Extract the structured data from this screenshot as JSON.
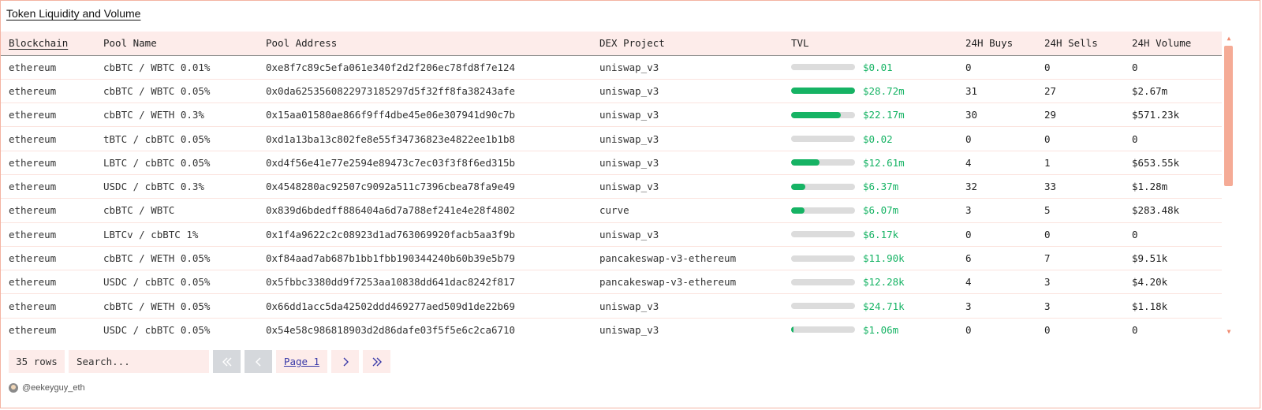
{
  "title": "Token Liquidity and Volume",
  "columns": [
    "Blockchain",
    "Pool Name",
    "Pool Address",
    "DEX Project",
    "TVL",
    "24H Buys",
    "24H Sells",
    "24H Volume"
  ],
  "rows": [
    {
      "chain": "ethereum",
      "pool": "cbBTC / WBTC 0.01%",
      "address": "0xe8f7c89c5efa061e340f2d2f206ec78fd8f7e124",
      "dex": "uniswap_v3",
      "tvl": "$0.01",
      "tvl_share": 0.0,
      "buys": "0",
      "sells": "0",
      "volume": "0"
    },
    {
      "chain": "ethereum",
      "pool": "cbBTC / WBTC 0.05%",
      "address": "0x0da6253560822973185297d5f32ff8fa38243afe",
      "dex": "uniswap_v3",
      "tvl": "$28.72m",
      "tvl_share": 1.0,
      "buys": "31",
      "sells": "27",
      "volume": "$2.67m"
    },
    {
      "chain": "ethereum",
      "pool": "cbBTC / WETH 0.3%",
      "address": "0x15aa01580ae866f9ff4dbe45e06e307941d90c7b",
      "dex": "uniswap_v3",
      "tvl": "$22.17m",
      "tvl_share": 0.772,
      "buys": "30",
      "sells": "29",
      "volume": "$571.23k"
    },
    {
      "chain": "ethereum",
      "pool": "tBTC / cbBTC 0.05%",
      "address": "0xd1a13ba13c802fe8e55f34736823e4822ee1b1b8",
      "dex": "uniswap_v3",
      "tvl": "$0.02",
      "tvl_share": 0.0,
      "buys": "0",
      "sells": "0",
      "volume": "0"
    },
    {
      "chain": "ethereum",
      "pool": "LBTC / cbBTC 0.05%",
      "address": "0xd4f56e41e77e2594e89473c7ec03f3f8f6ed315b",
      "dex": "uniswap_v3",
      "tvl": "$12.61m",
      "tvl_share": 0.439,
      "buys": "4",
      "sells": "1",
      "volume": "$653.55k"
    },
    {
      "chain": "ethereum",
      "pool": "USDC / cbBTC 0.3%",
      "address": "0x4548280ac92507c9092a511c7396cbea78fa9e49",
      "dex": "uniswap_v3",
      "tvl": "$6.37m",
      "tvl_share": 0.222,
      "buys": "32",
      "sells": "33",
      "volume": "$1.28m"
    },
    {
      "chain": "ethereum",
      "pool": "cbBTC / WBTC",
      "address": "0x839d6bdedff886404a6d7a788ef241e4e28f4802",
      "dex": "curve",
      "tvl": "$6.07m",
      "tvl_share": 0.211,
      "buys": "3",
      "sells": "5",
      "volume": "$283.48k"
    },
    {
      "chain": "ethereum",
      "pool": "LBTCv / cbBTC 1%",
      "address": "0x1f4a9622c2c08923d1ad763069920facb5aa3f9b",
      "dex": "uniswap_v3",
      "tvl": "$6.17k",
      "tvl_share": 0.0,
      "buys": "0",
      "sells": "0",
      "volume": "0"
    },
    {
      "chain": "ethereum",
      "pool": "cbBTC / WETH 0.05%",
      "address": "0xf84aad7ab687b1bb1fbb190344240b60b39e5b79",
      "dex": "pancakeswap-v3-ethereum",
      "tvl": "$11.90k",
      "tvl_share": 0.0,
      "buys": "6",
      "sells": "7",
      "volume": "$9.51k"
    },
    {
      "chain": "ethereum",
      "pool": "USDC / cbBTC 0.05%",
      "address": "0x5fbbc3380dd9f7253aa10838dd641dac8242f817",
      "dex": "pancakeswap-v3-ethereum",
      "tvl": "$12.28k",
      "tvl_share": 0.0,
      "buys": "4",
      "sells": "3",
      "volume": "$4.20k"
    },
    {
      "chain": "ethereum",
      "pool": "cbBTC / WETH 0.05%",
      "address": "0x66dd1acc5da42502ddd469277aed509d1de22b69",
      "dex": "uniswap_v3",
      "tvl": "$24.71k",
      "tvl_share": 0.0,
      "buys": "3",
      "sells": "3",
      "volume": "$1.18k"
    },
    {
      "chain": "ethereum",
      "pool": "USDC / cbBTC 0.05%",
      "address": "0x54e58c986818903d2d86dafe03f5f5e6c2ca6710",
      "dex": "uniswap_v3",
      "tvl": "$1.06m",
      "tvl_share": 0.037,
      "buys": "0",
      "sells": "0",
      "volume": "0"
    }
  ],
  "pagination": {
    "rows_label": "35 rows",
    "search_placeholder": "Search...",
    "first_icon": "double-chevron-left-icon",
    "prev_icon": "chevron-left-icon",
    "page_label": "Page 1",
    "next_icon": "chevron-right-icon",
    "last_icon": "double-chevron-right-icon"
  },
  "footer": {
    "handle": "@eekeyguy_eth"
  },
  "colors": {
    "accent_bg": "#fdecea",
    "tvl_green": "#16b364",
    "border": "#f3b4a3",
    "link": "#3a3aa8"
  }
}
